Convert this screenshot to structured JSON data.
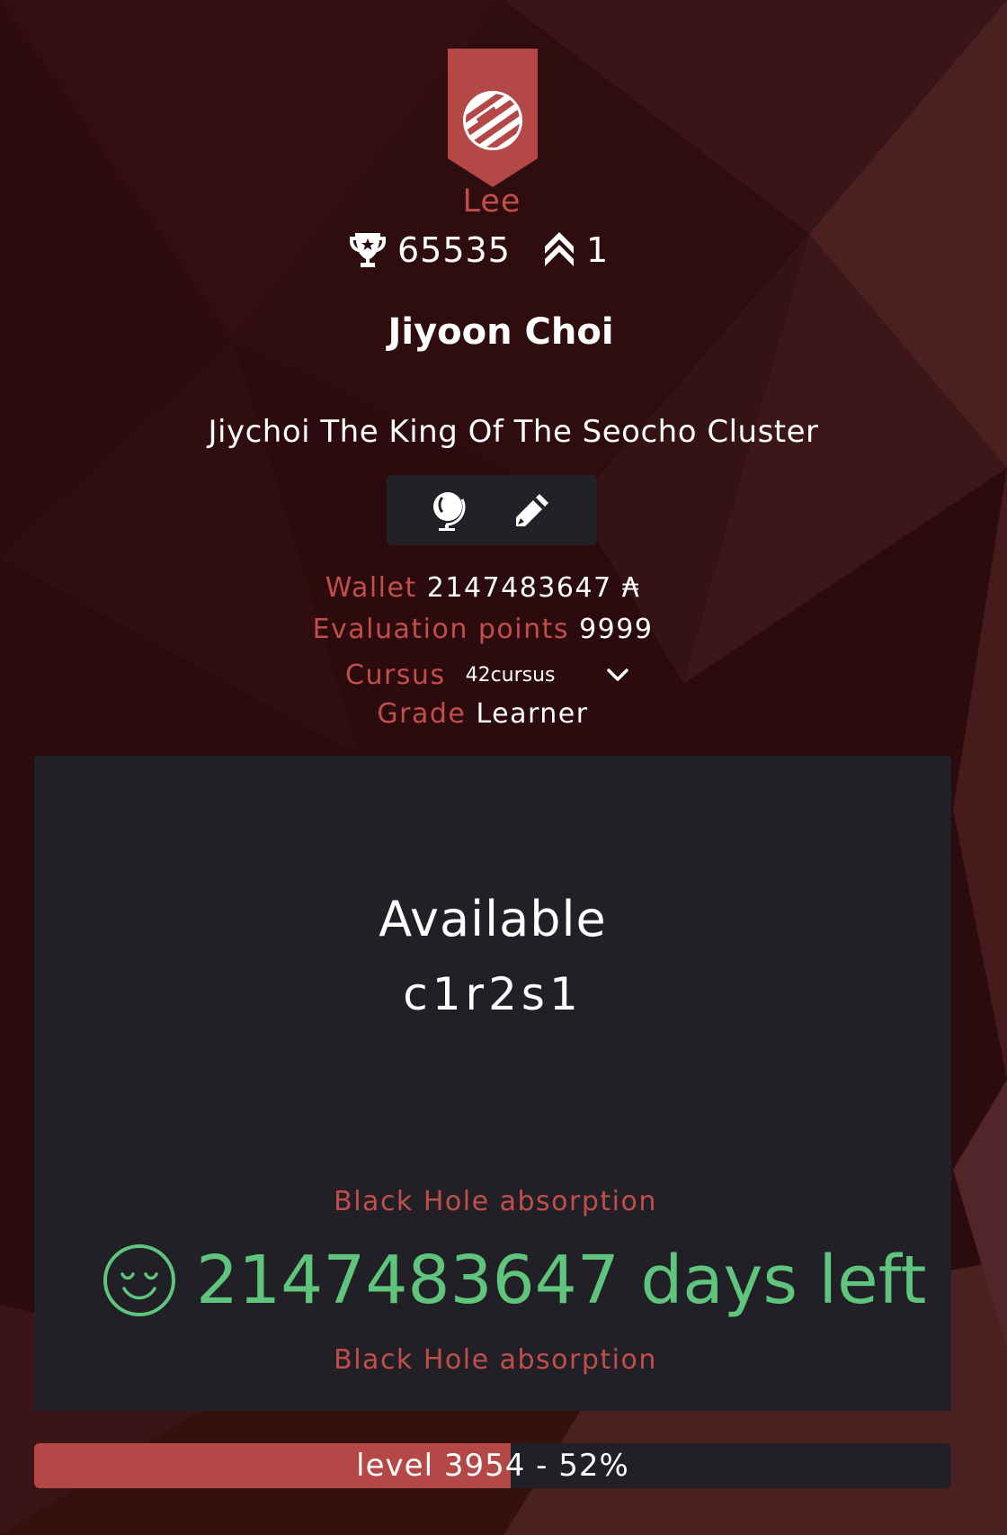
{
  "colors": {
    "accent": "#c24e4b",
    "panel": "#212026",
    "green": "#5fc57c",
    "background": "#2a0c0e"
  },
  "coalition": {
    "name": "Lee",
    "icon": "coalition-logo-icon"
  },
  "stats": {
    "trophy_icon": "trophy-icon",
    "trophy_value": "65535",
    "rank_icon": "chevrons-up-icon",
    "rank_value": "1"
  },
  "profile": {
    "login_name": "Jiyoon Choi",
    "display_title": "Jiychoi The King Of The Seocho Cluster"
  },
  "actions": {
    "globe_icon": "globe-icon",
    "edit_icon": "pencil-icon"
  },
  "info": {
    "wallet_label": "Wallet",
    "wallet_value": "2147483647 ₳",
    "eval_label": "Evaluation points",
    "eval_value": "9999",
    "cursus_label": "Cursus",
    "cursus_value": "42cursus",
    "grade_label": "Grade",
    "grade_value": "Learner"
  },
  "location": {
    "status": "Available",
    "host": "c1r2s1"
  },
  "blackhole": {
    "label_top": "Black Hole absorption",
    "days_text": "2147483647 days left",
    "label_bottom": "Black Hole absorption",
    "icon": "smiley-icon"
  },
  "level": {
    "text": "level 3954 - 52%",
    "progress": 0.52
  }
}
